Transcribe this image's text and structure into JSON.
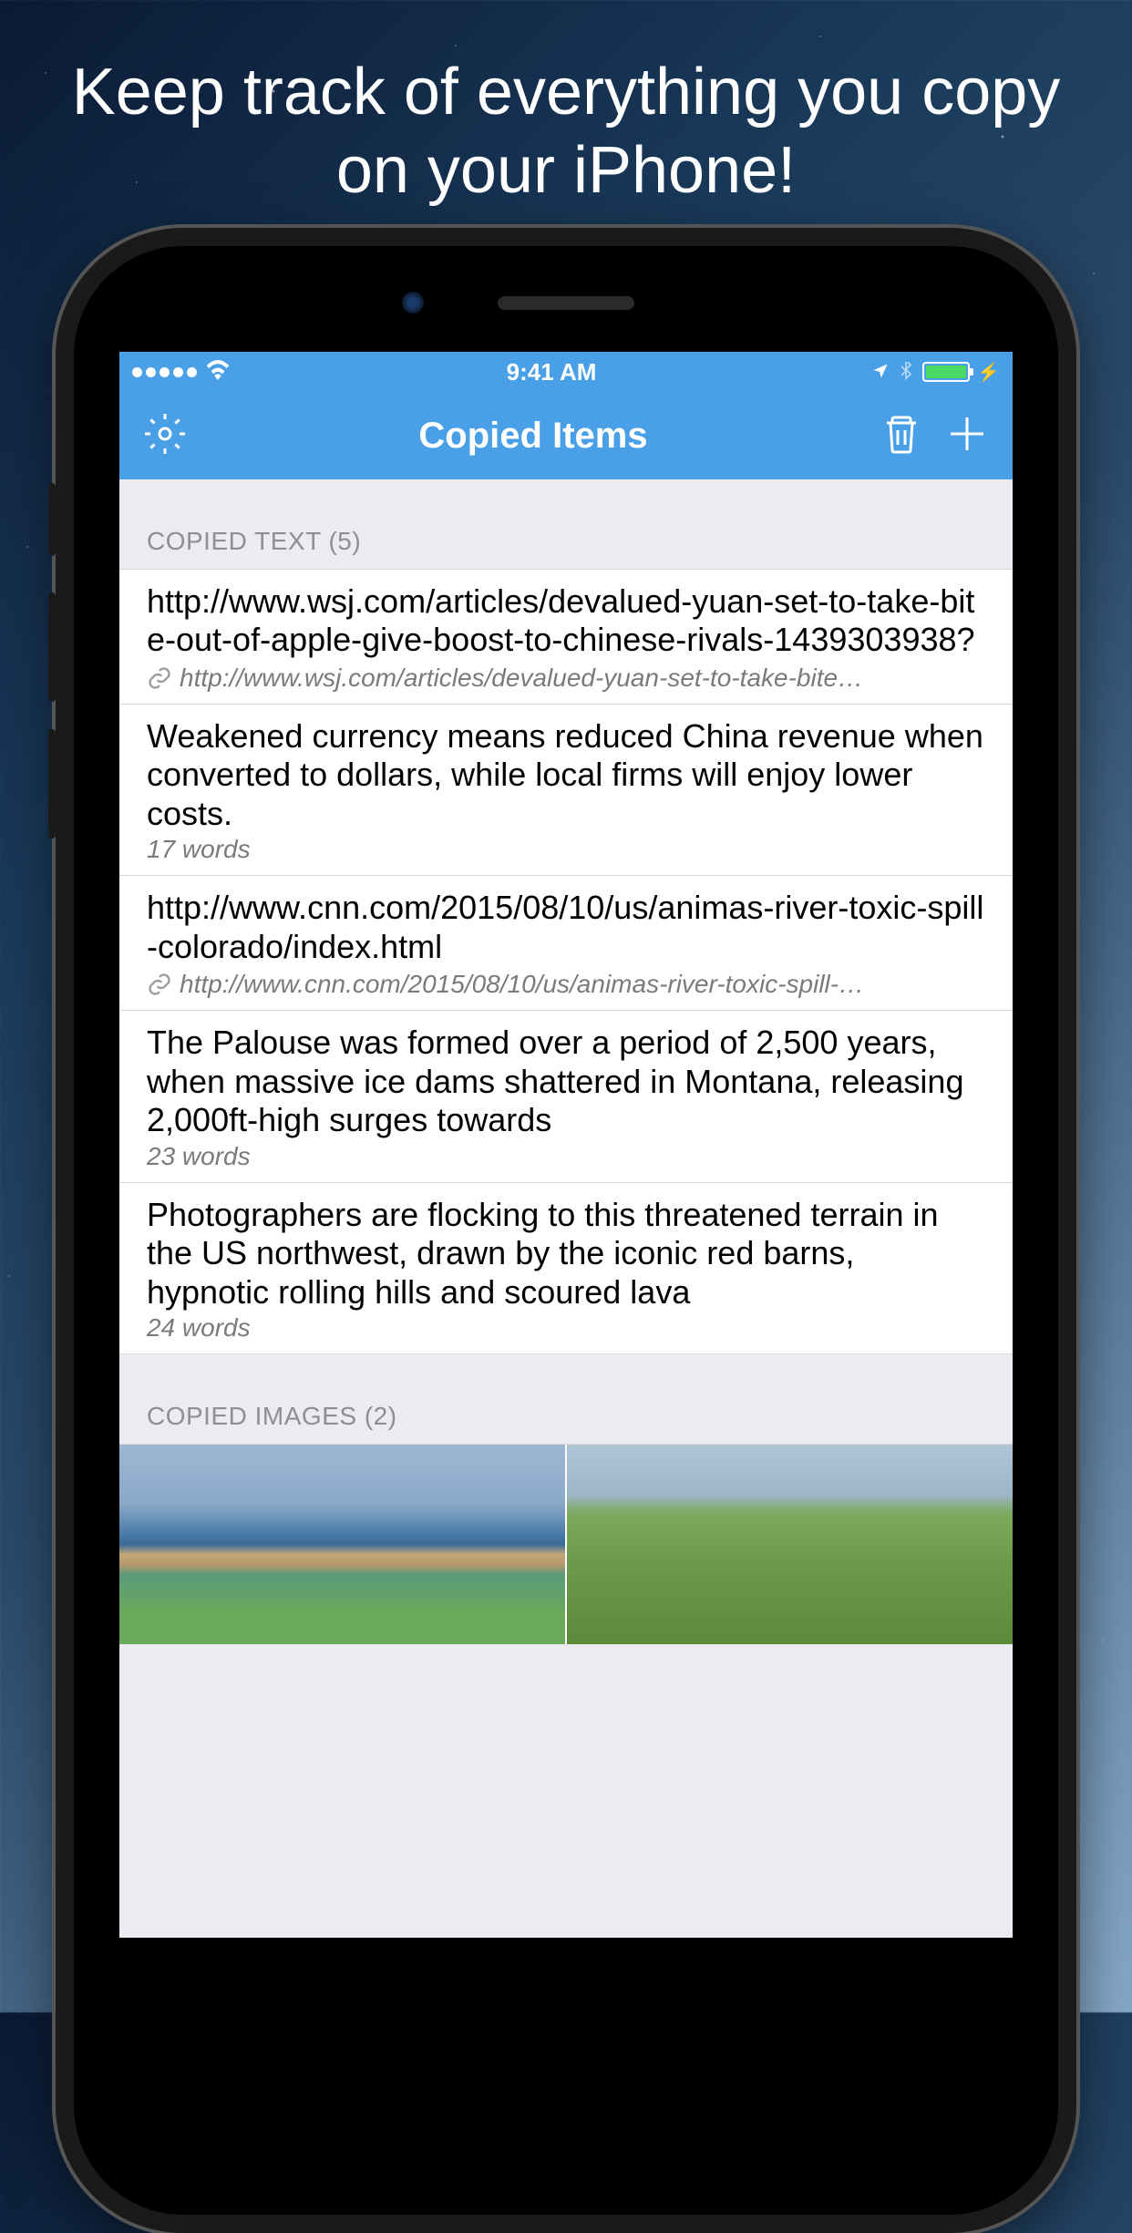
{
  "promo": {
    "headline": "Keep track of everything you copy on your iPhone!"
  },
  "status": {
    "time": "9:41 AM"
  },
  "nav": {
    "title": "Copied Items"
  },
  "sections": {
    "text_header": "COPIED TEXT (5)",
    "images_header": "COPIED IMAGES (2)"
  },
  "items": [
    {
      "text": "http://www.wsj.com/articles/devalued-yuan-set-to-take-bite-out-of-apple-give-boost-to-chinese-rivals-1439303938?",
      "sub": "http://www.wsj.com/articles/devalued-yuan-set-to-take-bite…",
      "is_link": true
    },
    {
      "text": "Weakened currency means reduced China revenue when converted to dollars, while local firms will enjoy lower costs.",
      "meta": "17 words",
      "is_link": false
    },
    {
      "text": "http://www.cnn.com/2015/08/10/us/animas-river-toxic-spill-colorado/index.html",
      "sub": "http://www.cnn.com/2015/08/10/us/animas-river-toxic-spill-…",
      "is_link": true
    },
    {
      "text": "The Palouse was formed over a period of 2,500 years, when massive ice dams shattered in Montana, releasing 2,000ft-high surges towards",
      "meta": "23 words",
      "is_link": false
    },
    {
      "text": "Photographers are flocking to this threatened terrain in the US northwest, drawn by the iconic red barns, hypnotic rolling hills and scoured lava",
      "meta": "24 words",
      "is_link": false
    }
  ]
}
